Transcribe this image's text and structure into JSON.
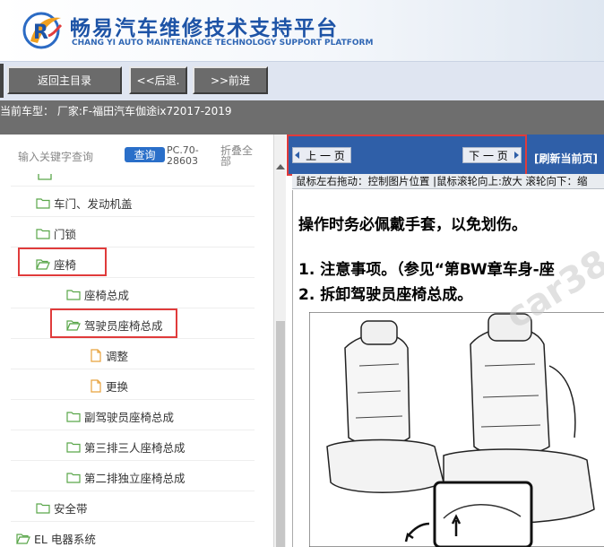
{
  "header": {
    "title_cn": "畅易汽车维修技术支持平台",
    "title_en": "CHANG YI AUTO MAINTENANCE TECHNOLOGY SUPPORT PLATFORM"
  },
  "nav": {
    "home_label": "返回主目录",
    "back_label": "<<后退.",
    "forward_label": ">>前进"
  },
  "current_model": "当前车型： 厂家:F-福田汽车伽途ix72017-2019",
  "left_panel": {
    "search_placeholder": "输入关键字查询",
    "search_button": "查询",
    "pc_code": "PC.70-28603",
    "collapse_all": "折叠全部",
    "tree": [
      {
        "label": "车门、发动机盖",
        "type": "folder",
        "level": 1
      },
      {
        "label": "门锁",
        "type": "folder",
        "level": 1
      },
      {
        "label": "座椅",
        "type": "folder-open",
        "level": 1
      },
      {
        "label": "座椅总成",
        "type": "folder",
        "level": 2
      },
      {
        "label": "驾驶员座椅总成",
        "type": "folder-open",
        "level": 2
      },
      {
        "label": "调整",
        "type": "doc",
        "level": 3
      },
      {
        "label": "更换",
        "type": "doc",
        "level": 3
      },
      {
        "label": "副驾驶员座椅总成",
        "type": "folder",
        "level": 2
      },
      {
        "label": "第三排三人座椅总成",
        "type": "folder",
        "level": 2
      },
      {
        "label": "第二排独立座椅总成",
        "type": "folder",
        "level": 2
      },
      {
        "label": "安全带",
        "type": "folder",
        "level": 1
      },
      {
        "label": "EL 电器系统",
        "type": "folder-open",
        "level": 0
      }
    ]
  },
  "right_panel": {
    "prev_page": "上 一 页",
    "next_page": "下 一 页",
    "refresh": "[刷新当前页]",
    "hint": "鼠标左右拖动：控制图片位置 |鼠标滚轮向上:放大  滚轮向下：缩",
    "doc_lines": [
      "操作时务必佩戴手套，以免划伤。",
      "1.  注意事项。（参见“第BW章车身-座",
      "2.  拆卸驾驶员座椅总成。"
    ],
    "watermark": "car38"
  },
  "colors": {
    "title_blue": "#1d53a6",
    "toolbar_blue": "#2f5fa8",
    "highlight_red": "#e03b3b",
    "folder_green": "#5aa64a",
    "doc_orange": "#e8a23c"
  }
}
